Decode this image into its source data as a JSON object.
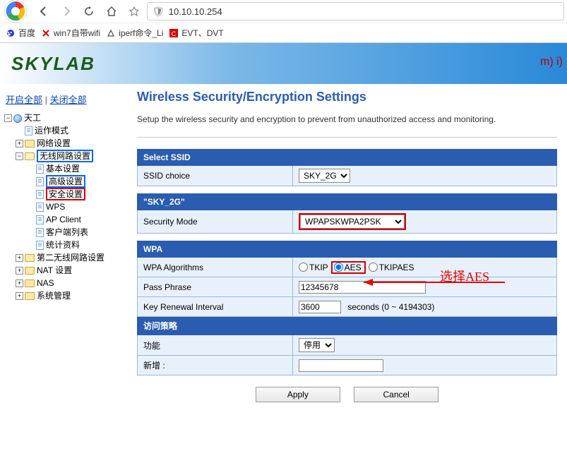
{
  "browser": {
    "url": "10.10.10.254",
    "bookmarks": {
      "baidu": "百度",
      "win7wifi": "win7自带wifi",
      "iperf": "iperf命令_Li",
      "evt": "EVT、DVT"
    }
  },
  "logo_text": "SKYLAB",
  "banner_right": "m) i)",
  "tree_controls": {
    "open_all": "开启全部",
    "close_all": "关闭全部"
  },
  "tree": {
    "root": "天工",
    "op_mode": "运作模式",
    "net_settings": "网络设置",
    "wireless": "无线网路设置",
    "basic": "基本设置",
    "advanced": "高级设置",
    "security": "安全设置",
    "wps": "WPS",
    "apclient": "AP Client",
    "clients": "客户端列表",
    "stats": "统计资料",
    "wireless2": "第二无线网路设置",
    "nat": "NAT 设置",
    "nas": "NAS",
    "sysadmin": "系统管理"
  },
  "page_title": "Wireless Security/Encryption Settings",
  "page_desc": "Setup the wireless security and encryption to prevent from unauthorized access and monitoring.",
  "sections": {
    "select_ssid": {
      "header": "Select SSID",
      "ssid_choice_label": "SSID choice",
      "ssid_value": "SKY_2G"
    },
    "ssid_detail": {
      "header": "\"SKY_2G\"",
      "sec_mode_label": "Security Mode",
      "sec_mode_value": "WPAPSKWPA2PSK"
    },
    "wpa": {
      "header": "WPA",
      "algo_label": "WPA Algorithms",
      "tkip": "TKIP",
      "aes": "AES",
      "tkipaes": "TKIPAES",
      "pass_label": "Pass Phrase",
      "pass_value": "12345678",
      "renew_label": "Key Renewal Interval",
      "renew_value": "3600",
      "renew_suffix": "seconds   (0 ~ 4194303)"
    },
    "access": {
      "header": "访问策略",
      "func_label": "功能",
      "func_value": "停用",
      "add_label": "新增 :"
    }
  },
  "annotation": "选择AES",
  "buttons": {
    "apply": "Apply",
    "cancel": "Cancel"
  }
}
